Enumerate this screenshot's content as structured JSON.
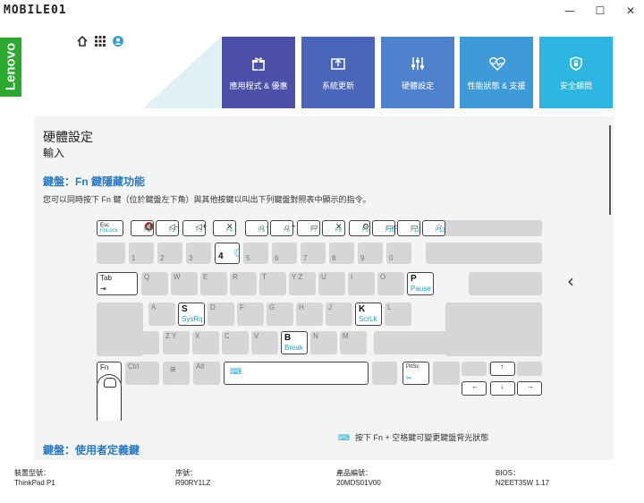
{
  "watermark": "MOBILE01",
  "window": {
    "minimize": "—",
    "maximize": "☐",
    "close": "✕"
  },
  "brand": {
    "logo": "Lenovo",
    "color": "#2ba82e"
  },
  "tiles": [
    {
      "label": "應用程式 & 優惠",
      "icon": "gift-icon",
      "color": "#4d50a8"
    },
    {
      "label": "系統更新",
      "icon": "update-icon",
      "color": "#4b65b8"
    },
    {
      "label": "硬體設定",
      "icon": "sliders-icon",
      "color": "#4e82cc"
    },
    {
      "label": "性能狀態 & 支援",
      "icon": "heartbeat-icon",
      "color": "#3f9ad8"
    },
    {
      "label": "安全顧問",
      "icon": "shield-icon",
      "color": "#2db6e1"
    }
  ],
  "content": {
    "title": "硬體設定",
    "subtitle": "輸入",
    "section1": "鍵盤：Fn 鍵隱藏功能",
    "description": "您可以同時按下 Fn 鍵（位於鍵盤左下角）與其他按鍵以叫出下列鍵盤對照表中顯示的指令。",
    "backlight_note": "按下 Fn + 空格鍵可變更鍵盤背光狀態",
    "section2": "鍵盤：使用者定義鍵"
  },
  "keyboard": {
    "esc": "Esc",
    "esc_fn": "FnLock",
    "fkeys": [
      "F1",
      "F2",
      "F3",
      "F4",
      "F5",
      "F6",
      "F7",
      "F8",
      "F9",
      "F10",
      "F11",
      "F12"
    ],
    "fkey_icons": [
      "🔇",
      "◁-",
      "◁+",
      "✕",
      "☼-",
      "☼+",
      "▭",
      "✕",
      "⚙",
      "▭▭",
      "▭",
      "☆"
    ],
    "digits": [
      "1",
      "2",
      "3",
      "4",
      "5",
      "6",
      "7",
      "8",
      "9",
      "0"
    ],
    "row2": [
      "Q",
      "W",
      "E",
      "R",
      "T",
      "Y Z",
      "U",
      "I",
      "O",
      "P"
    ],
    "row3": [
      "A",
      "S",
      "D",
      "F",
      "G",
      "H",
      "J",
      "K",
      "L"
    ],
    "row4": [
      "Z Y",
      "X",
      "C",
      "V",
      "B",
      "N",
      "M"
    ],
    "tab": "Tab",
    "four": "4",
    "s_fn": "SysRq",
    "k_fn": "ScrLk",
    "p_fn": "Pause",
    "b_fn": "Break",
    "fn": "Fn",
    "ctrl": "Ctrl",
    "alt": "Alt",
    "prtsc": "PrtSc"
  },
  "footer": [
    {
      "label": "裝置型號：",
      "value": "ThinkPad P1"
    },
    {
      "label": "序號：",
      "value": "R90RY1LZ"
    },
    {
      "label": "產品編號：",
      "value": "20MDS01V00"
    },
    {
      "label": "BIOS：",
      "value": "N2EET35W 1.17"
    }
  ]
}
